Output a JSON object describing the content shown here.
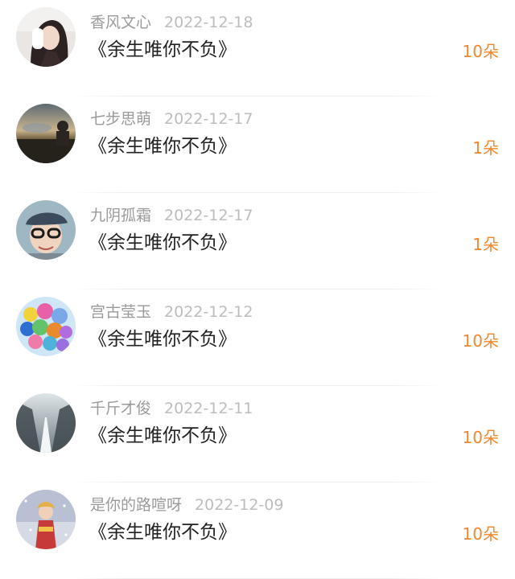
{
  "colors": {
    "name": "#9a9a9a",
    "date": "#bdbdbd",
    "title": "#222222",
    "count_accent": "#f0862d"
  },
  "items": [
    {
      "name": "香风文心",
      "date": "2022-12-18",
      "title": "《余生唯你不负》",
      "count": "10朵",
      "avatar": "avatar-woman-portrait"
    },
    {
      "name": "七步思萌",
      "date": "2022-12-17",
      "title": "《余生唯你不负》",
      "count": "1朵",
      "avatar": "avatar-sunset-landscape"
    },
    {
      "name": "九阴孤霜",
      "date": "2022-12-17",
      "title": "《余生唯你不负》",
      "count": "1朵",
      "avatar": "avatar-child-with-cap"
    },
    {
      "name": "宫古莹玉",
      "date": "2022-12-12",
      "title": "《余生唯你不负》",
      "count": "10朵",
      "avatar": "avatar-balloons"
    },
    {
      "name": "千斤才俊",
      "date": "2022-12-11",
      "title": "《余生唯你不负》",
      "count": "10朵",
      "avatar": "avatar-snowy-trees"
    },
    {
      "name": "是你的路喧呀",
      "date": "2022-12-09",
      "title": "《余生唯你不负》",
      "count": "10朵",
      "avatar": "avatar-girl-in-snow"
    }
  ]
}
